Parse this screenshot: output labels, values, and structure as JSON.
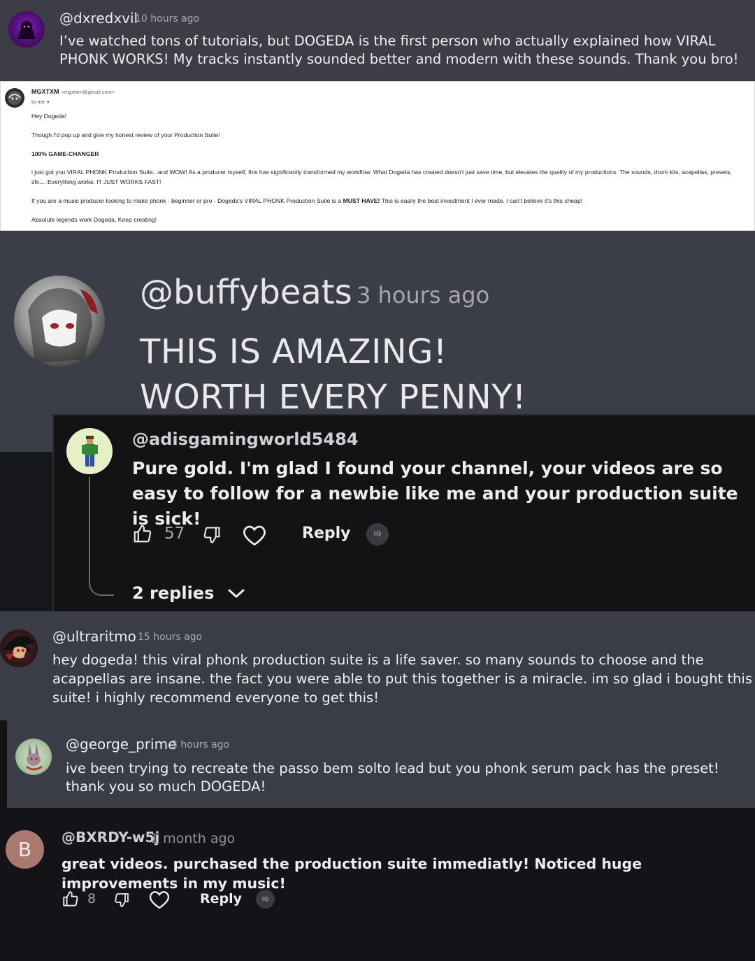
{
  "comment1": {
    "handle": "@dxredxvil",
    "time": "10 hours ago",
    "text": "I’ve watched tons of tutorials, but DOGEDA is the first person who actually explained how VIRAL PHONK WORKS! My tracks instantly sounded better and modern with these sounds. Thank you bro!"
  },
  "email": {
    "sender": "MGXTXM",
    "address": "<mgxtxm@gmail.com>",
    "to": "to me",
    "greeting": "Hey Dogeda!",
    "intro": "Though I'd pop up and give my honest review of your Production Suite!",
    "headline": "100% GAME-CHANGER",
    "para1": "i just got you VIRAL PHONK Production Suite...and WOW! As a producer myself, this has significantly transformed my workflow. What Dogeda has created doesn't just save time, but elevates the quality of my productions. The sounds, drum kits, acapellas, presets, sfx.... Everything works. IT JUST WORKS FAST!",
    "para2_a": "If you are a music producer looking to make phonk - beginner or pro - Dogeda's VIRAL PHONK Production Suite is a ",
    "para2_bold": "MUST HAVE!",
    "para2_b": " This is easily the best investment I ever made. I can't believe it's this cheap!",
    "closing": "Absolute legends work Dogeda, Keep creating!"
  },
  "comment3": {
    "handle": "@buffybeats",
    "time": "3 hours ago",
    "line1": "THIS IS AMAZING!",
    "line2": "WORTH EVERY PENNY!"
  },
  "comment4": {
    "handle": "@adisgamingworld5484",
    "text": "Pure gold. I'm glad I found your channel, your videos are so easy to follow for a newbie like me and your production suite is sick!",
    "likes": "57",
    "reply_label": "Reply",
    "badge": "IQ",
    "replies_label": "2 replies"
  },
  "comment5": {
    "handle": "@ultraritmo",
    "time": "15 hours ago",
    "text": "hey dogeda! this viral phonk production suite is a life saver. so many sounds to choose and the acappellas are insane. the fact you were able to put this together is a miracle. im so glad i bought this suite! i highly recommend everyone to get this!"
  },
  "comment6": {
    "handle": "@george_prime",
    "time": "3 hours ago",
    "text": "ive been trying to recreate the passo bem solto lead but you phonk serum pack has the preset! thank you so much DOGEDA!"
  },
  "comment7": {
    "avatar_letter": "B",
    "handle": "@BXRDY-w5j",
    "time": "1 month ago",
    "text": "great videos. purchased the production suite immediatly! Noticed huge improvements in my music!",
    "likes": "8",
    "reply_label": "Reply",
    "badge": "IQ"
  },
  "colors": {
    "panel_gray": "#3b3d46",
    "panel_dark": "#131316",
    "avatar_b": "#a9786f"
  }
}
